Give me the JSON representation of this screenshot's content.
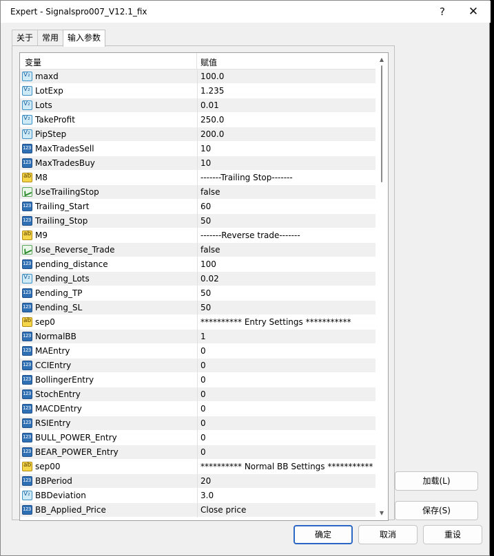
{
  "window": {
    "title": "Expert - Signalspro007_V12.1_fix",
    "help_label": "?",
    "close_label": "✕"
  },
  "tabs": [
    {
      "label": "关于"
    },
    {
      "label": "常用"
    },
    {
      "label": "输入参数"
    }
  ],
  "table": {
    "headers": {
      "variable": "变量",
      "value": "赋值"
    },
    "rows": [
      {
        "icon": "double-icon",
        "name": "maxd",
        "value": "100.0"
      },
      {
        "icon": "double-icon",
        "name": "LotExp",
        "value": "1.235"
      },
      {
        "icon": "double-icon",
        "name": "Lots",
        "value": "0.01"
      },
      {
        "icon": "double-icon",
        "name": "TakeProfit",
        "value": "250.0"
      },
      {
        "icon": "double-icon",
        "name": "PipStep",
        "value": "200.0"
      },
      {
        "icon": "integer-icon",
        "name": "MaxTradesSell",
        "value": "10"
      },
      {
        "icon": "integer-icon",
        "name": "MaxTradesBuy",
        "value": "10"
      },
      {
        "icon": "string-icon",
        "name": "M8",
        "value": "-------Trailing Stop-------"
      },
      {
        "icon": "bool-icon",
        "name": "UseTrailingStop",
        "value": "false"
      },
      {
        "icon": "integer-icon",
        "name": "Trailing_Start",
        "value": "60"
      },
      {
        "icon": "integer-icon",
        "name": "Trailing_Stop",
        "value": "50"
      },
      {
        "icon": "string-icon",
        "name": "M9",
        "value": "-------Reverse trade-------"
      },
      {
        "icon": "bool-icon",
        "name": "Use_Reverse_Trade",
        "value": "false"
      },
      {
        "icon": "integer-icon",
        "name": "pending_distance",
        "value": "100"
      },
      {
        "icon": "double-icon",
        "name": "Pending_Lots",
        "value": "0.02"
      },
      {
        "icon": "integer-icon",
        "name": "Pending_TP",
        "value": "50"
      },
      {
        "icon": "integer-icon",
        "name": "Pending_SL",
        "value": "50"
      },
      {
        "icon": "string-icon",
        "name": "sep0",
        "value": "********** Entry Settings ***********"
      },
      {
        "icon": "integer-icon",
        "name": "NormalBB",
        "value": "1"
      },
      {
        "icon": "integer-icon",
        "name": "MAEntry",
        "value": "0"
      },
      {
        "icon": "integer-icon",
        "name": "CCIEntry",
        "value": "0"
      },
      {
        "icon": "integer-icon",
        "name": "BollingerEntry",
        "value": "0"
      },
      {
        "icon": "integer-icon",
        "name": "StochEntry",
        "value": "0"
      },
      {
        "icon": "integer-icon",
        "name": "MACDEntry",
        "value": "0"
      },
      {
        "icon": "integer-icon",
        "name": "RSIEntry",
        "value": "0"
      },
      {
        "icon": "integer-icon",
        "name": "BULL_POWER_Entry",
        "value": "0"
      },
      {
        "icon": "integer-icon",
        "name": "BEAR_POWER_Entry",
        "value": "0"
      },
      {
        "icon": "string-icon",
        "name": "sep00",
        "value": "********** Normal BB Settings ***********"
      },
      {
        "icon": "integer-icon",
        "name": "BBPeriod",
        "value": "20"
      },
      {
        "icon": "double-icon",
        "name": "BBDeviation",
        "value": "3.0"
      },
      {
        "icon": "integer-icon",
        "name": "BB_Applied_Price",
        "value": "Close price"
      }
    ]
  },
  "buttons": {
    "load": "加载(L)",
    "save": "保存(S)",
    "ok": "确定",
    "cancel": "取消",
    "reset": "重设"
  }
}
